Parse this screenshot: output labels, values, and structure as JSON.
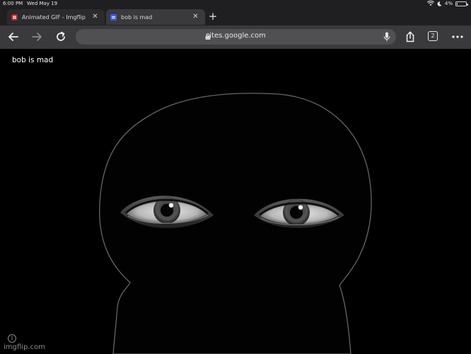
{
  "status_bar": {
    "time": "6:00 PM",
    "date": "Wed May 19",
    "battery_percent_label": "4%",
    "battery_level": 0.04
  },
  "tabs": [
    {
      "label": "Animated GIF - Imgflip",
      "favicon": "imgflip-favicon-icon",
      "active": false
    },
    {
      "label": "bob is mad",
      "favicon": "google-sites-favicon-icon",
      "active": true
    }
  ],
  "toolbar": {
    "url": "sites.google.com",
    "tab_count": "2"
  },
  "page": {
    "title": "bob is mad"
  },
  "watermark": {
    "info_glyph": "i",
    "text": "imgflip.com"
  },
  "colors": {
    "chrome_dark": "#1f1f21",
    "toolbar": "#3a3a3d",
    "urlbar": "#505053",
    "page_bg": "#000000"
  }
}
